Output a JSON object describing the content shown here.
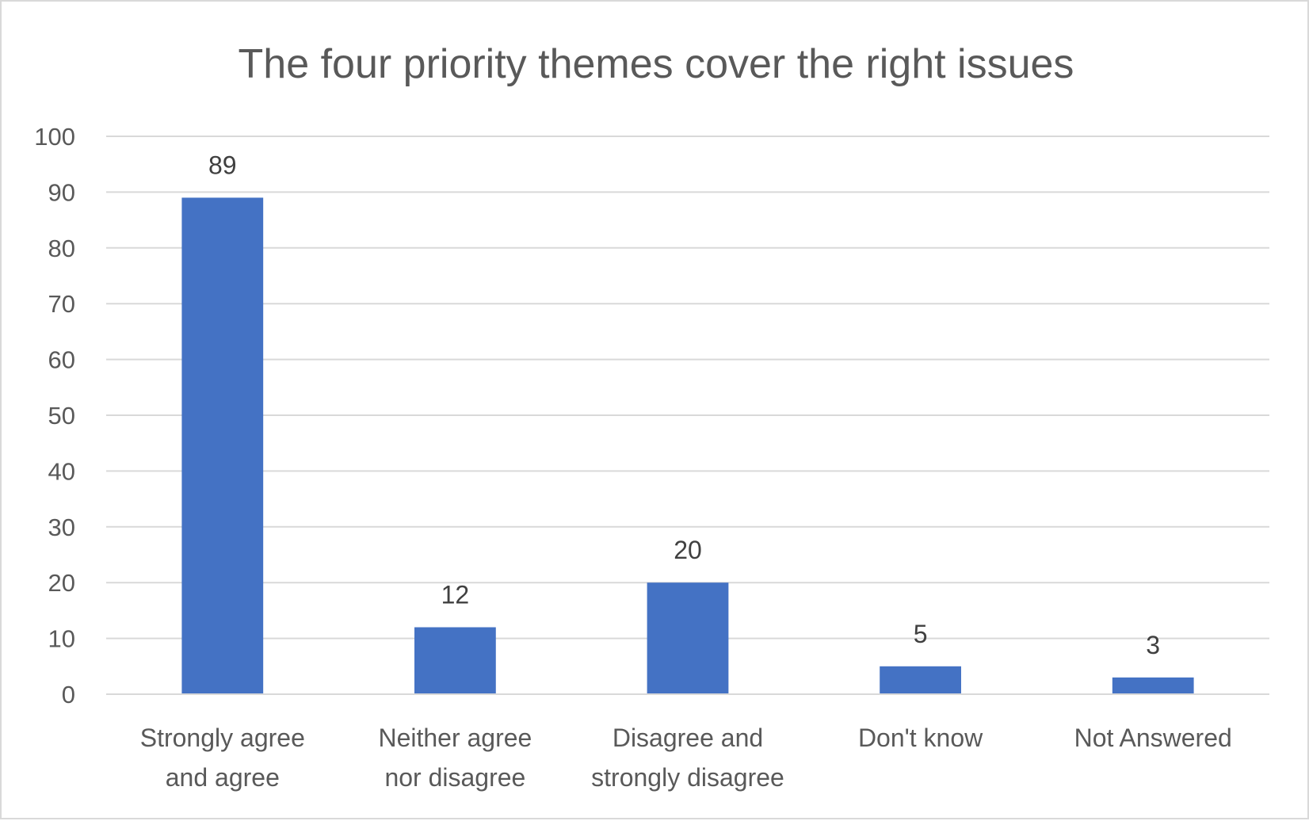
{
  "chart_data": {
    "type": "bar",
    "title": "The four priority themes cover the right issues",
    "categories": [
      [
        "Strongly agree",
        "and agree"
      ],
      [
        "Neither agree",
        "nor disagree"
      ],
      [
        "Disagree and",
        "strongly disagree"
      ],
      [
        "Don't know"
      ],
      [
        "Not Answered"
      ]
    ],
    "values": [
      89,
      12,
      20,
      5,
      3
    ],
    "data_labels": [
      "89",
      "12",
      "20",
      "5",
      "3"
    ],
    "xlabel": "",
    "ylabel": "",
    "ylim": [
      0,
      100
    ],
    "yticks": [
      0,
      10,
      20,
      30,
      40,
      50,
      60,
      70,
      80,
      90,
      100
    ],
    "grid": true,
    "legend": "none",
    "bar_color": "#4472c4",
    "grid_color": "#d9d9d9"
  }
}
